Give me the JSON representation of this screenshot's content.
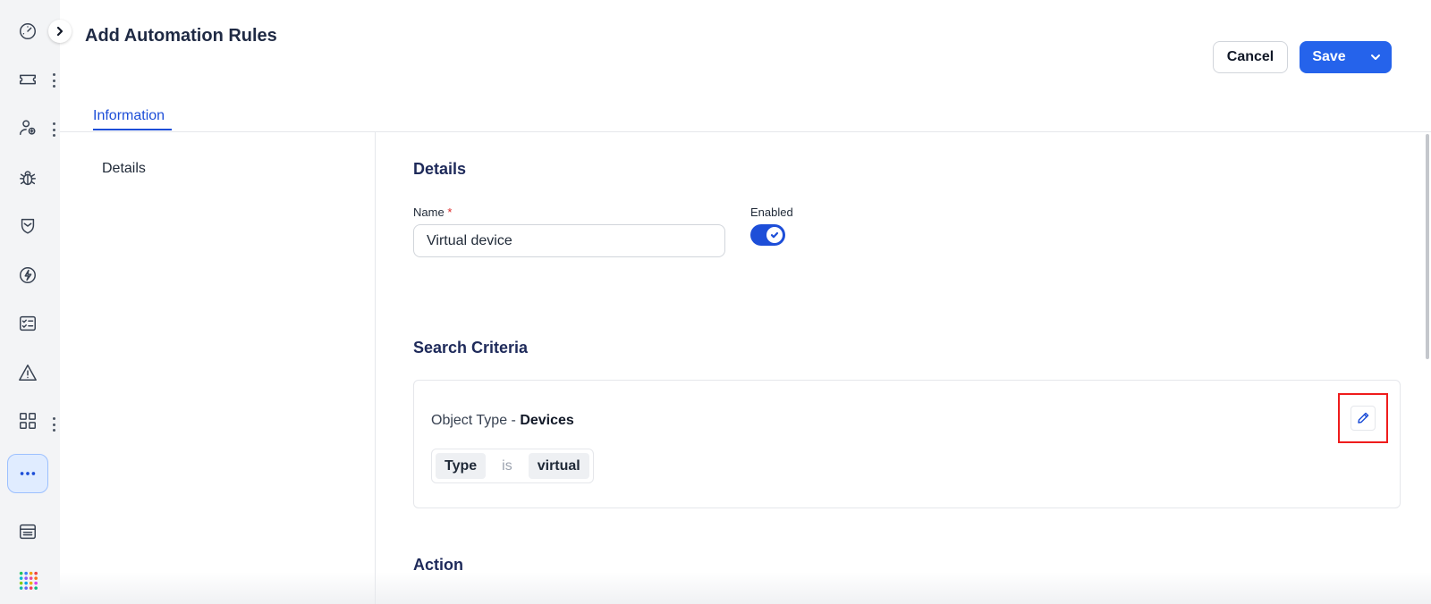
{
  "header": {
    "title": "Add Automation Rules",
    "cancel_label": "Cancel",
    "save_label": "Save"
  },
  "tabs": [
    {
      "label": "Information",
      "active": true
    }
  ],
  "subnav": {
    "items": [
      {
        "label": "Details"
      }
    ]
  },
  "details": {
    "section_title": "Details",
    "name_label": "Name",
    "name_required_mark": "*",
    "name_value": "Virtual device",
    "enabled_label": "Enabled",
    "enabled": true
  },
  "search_criteria": {
    "section_title": "Search Criteria",
    "object_type_prefix": "Object Type - ",
    "object_type_value": "Devices",
    "condition": {
      "field": "Type",
      "operator": "is",
      "value": "virtual"
    }
  },
  "action": {
    "section_title": "Action"
  },
  "rail": {
    "icons": [
      "dashboard-icon",
      "ticket-icon",
      "user-settings-icon",
      "bug-icon",
      "shield-icon",
      "lightning-icon",
      "checklist-icon",
      "warning-icon",
      "apps-grid-icon",
      "more-icon",
      "table-icon",
      "color-dots-icon"
    ]
  },
  "colors": {
    "primary": "#2563eb",
    "highlight": "#ef1c1c",
    "rail_bg": "#f3f4f6"
  }
}
